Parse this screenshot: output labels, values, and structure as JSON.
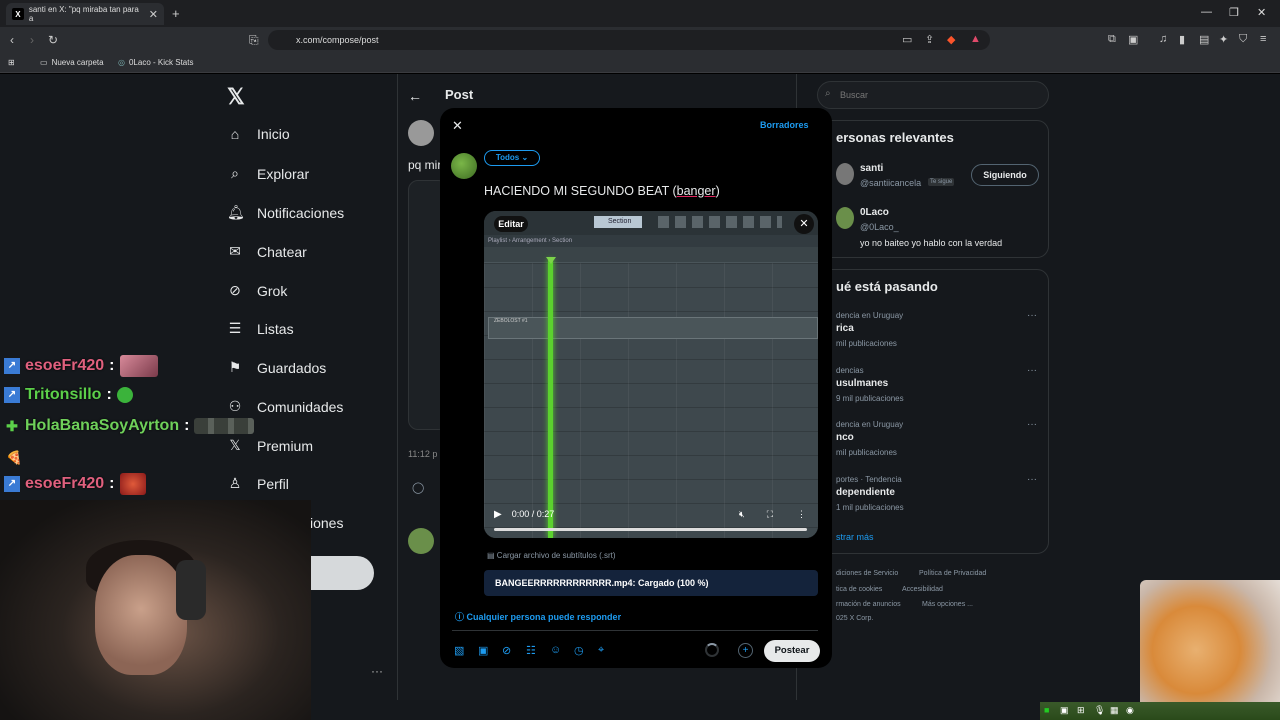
{
  "browser": {
    "tab_title": "santi en X: \"pq miraba tan para a",
    "url": "x.com/compose/post",
    "bookmarks": [
      "Nueva carpeta",
      "0Laco - Kick Stats"
    ]
  },
  "sidebar": {
    "items": [
      {
        "label": "Inicio",
        "icon": "home-icon"
      },
      {
        "label": "Explorar",
        "icon": "search-icon"
      },
      {
        "label": "Notificaciones",
        "icon": "bell-icon"
      },
      {
        "label": "Chatear",
        "icon": "mail-icon"
      },
      {
        "label": "Grok",
        "icon": "grok-icon"
      },
      {
        "label": "Listas",
        "icon": "list-icon"
      },
      {
        "label": "Guardados",
        "icon": "bookmark-icon"
      },
      {
        "label": "Comunidades",
        "icon": "people-icon"
      },
      {
        "label": "Premium",
        "icon": "x-icon"
      },
      {
        "label": "Perfil",
        "icon": "person-icon"
      },
      {
        "label": "iones",
        "icon": "more-icon"
      }
    ],
    "post_button": "r"
  },
  "center": {
    "title": "Post",
    "bg_text": "pq mir",
    "bg_time": "11:12 p"
  },
  "right": {
    "search_placeholder": "Buscar",
    "relevant_title": "ersonas relevantes",
    "people": [
      {
        "name": "santi",
        "handle": "@santiicancela",
        "tag": "Te sigue",
        "button": "Siguiendo"
      },
      {
        "name": "0Laco",
        "handle": "@0Laco_",
        "bio": "yo no baiteo yo hablo con la verdad"
      }
    ],
    "trends_title": "ué está pasando",
    "trends": [
      {
        "category": "dencia en Uruguay",
        "name": "rica",
        "count": "mil publicaciones"
      },
      {
        "category": "dencias",
        "name": "usulmanes",
        "count": "9 mil publicaciones"
      },
      {
        "category": "dencia en Uruguay",
        "name": "nco",
        "count": "mil publicaciones"
      },
      {
        "category": "portes · Tendencia",
        "name": "dependiente",
        "count": "1 mil publicaciones"
      }
    ],
    "show_more": "strar más",
    "footer": [
      "diciones de Servicio",
      "Política de Privacidad",
      "tica de cookies",
      "Accesibilidad",
      "rmación de anuncios",
      "Más opciones ...",
      "025 X Corp."
    ]
  },
  "modal": {
    "drafts": "Borradores",
    "audience": "Todos",
    "text_before": "HACIENDO MI SEGUNDO BEAT (",
    "text_underlined": "banger",
    "text_after": ")",
    "video": {
      "edit_label": "Editar",
      "time": "0:00 / 0:27",
      "fl_toolbar_section": "Section",
      "fl_sub": "Playlist › Arrangement › Section",
      "track_label": "ZEBOLOST #1",
      "progress": 0.0
    },
    "subtitles_label": "Cargar archivo de subtítulos (.srt)",
    "upload_status": "BANGEERRRRRRRRRRRR.mp4: Cargado (100 %)",
    "reply_setting": "Cualquier persona puede responder",
    "post_button": "Postear"
  },
  "chat": [
    {
      "user": "esoeFr420",
      "color": "#e0607e",
      "badge": "prime"
    },
    {
      "user": "Tritonsillo",
      "color": "#5cd04a",
      "badge": "prime"
    },
    {
      "user": "HolaBanaSoyAyrton",
      "color": "#6fd05a",
      "badge": "sub"
    },
    {
      "user": "esoeFr420",
      "color": "#e0607e",
      "badge": "prime"
    }
  ],
  "colors": {
    "accent": "#1d9bf0",
    "bg": "#15181c",
    "playhead": "#5bd12e"
  }
}
